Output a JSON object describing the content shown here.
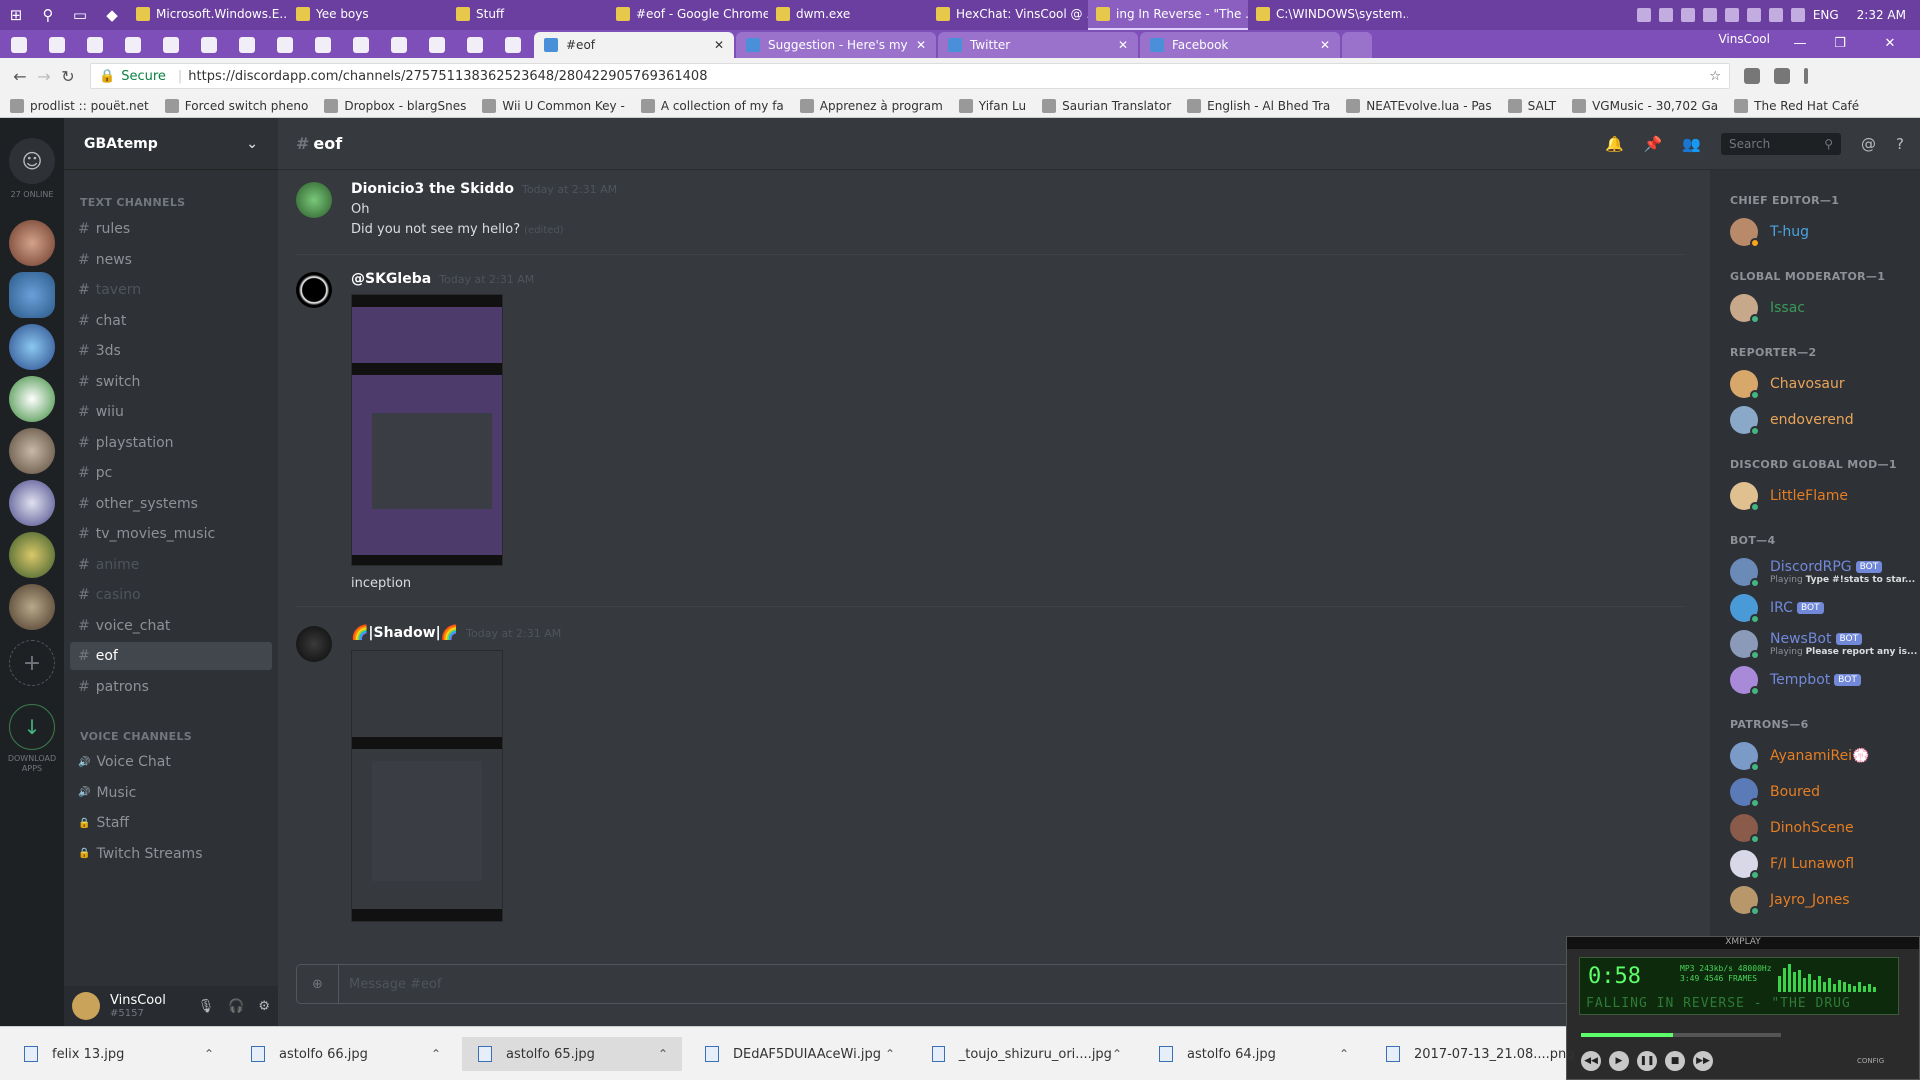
{
  "taskbar": {
    "apps": [
      "Microsoft.Windows.E...",
      "Yee boys",
      "Stuff",
      "#eof - Google Chrome",
      "dwm.exe",
      "HexChat: VinsCool @ ...",
      "ing In Reverse - \"The ...",
      "C:\\WINDOWS\\system..."
    ],
    "active_index": 6,
    "lang": "ENG",
    "clock": "2:32 AM"
  },
  "chrome": {
    "tabs": [
      "#eof",
      "Suggestion - Here's my i",
      "Twitter",
      "Facebook"
    ],
    "window_user": "VinsCool",
    "secure_label": "Secure",
    "url": "https://discordapp.com/channels/275751138362523648/280422905769361408"
  },
  "bookmarks": [
    "prodlist :: pouët.net",
    "Forced switch pheno",
    "Dropbox - blargSnes",
    "Wii U Common Key -",
    "A collection of my fa",
    "Apprenez à program",
    "Yifan Lu",
    "Saurian Translator",
    "English - Al Bhed Tra",
    "NEATEvolve.lua - Pas",
    "SALT",
    "VGMusic - 30,702 Ga",
    "The Red Hat Café"
  ],
  "discord": {
    "online_count": "27 ONLINE",
    "download_label": "DOWNLOAD APPS",
    "server_name": "GBAtemp",
    "text_category": "TEXT CHANNELS",
    "voice_category": "VOICE CHANNELS",
    "text_channels": [
      {
        "name": "rules",
        "dim": false
      },
      {
        "name": "news",
        "dim": false
      },
      {
        "name": "tavern",
        "dim": true
      },
      {
        "name": "chat",
        "dim": false
      },
      {
        "name": "3ds",
        "dim": false
      },
      {
        "name": "switch",
        "dim": false
      },
      {
        "name": "wiiu",
        "dim": false
      },
      {
        "name": "playstation",
        "dim": false
      },
      {
        "name": "pc",
        "dim": false
      },
      {
        "name": "other_systems",
        "dim": false
      },
      {
        "name": "tv_movies_music",
        "dim": false
      },
      {
        "name": "anime",
        "dim": true
      },
      {
        "name": "casino",
        "dim": true
      },
      {
        "name": "voice_chat",
        "dim": false
      },
      {
        "name": "eof",
        "dim": false,
        "selected": true
      },
      {
        "name": "patrons",
        "dim": false
      }
    ],
    "voice_channels": [
      "Voice Chat",
      "Music",
      "Staff",
      "Twitch Streams"
    ],
    "user": {
      "name": "VinsCool",
      "tag": "#5157"
    },
    "channel_title": "eof",
    "search_placeholder": "Search",
    "messages": [
      {
        "author": "Dionicio3 the Skiddo",
        "time": "Today at 2:31 AM",
        "lines": [
          "Oh",
          "Did you not see my hello?"
        ],
        "edited": "(edited)"
      },
      {
        "author": "@SKGleba",
        "time": "Today at 2:31 AM",
        "caption": "inception"
      },
      {
        "author": "🌈|Shadow|🌈",
        "time": "Today at 2:31 AM"
      }
    ],
    "composer_placeholder": "Message #eof",
    "member_groups": [
      {
        "title": "CHIEF EDITOR—1",
        "members": [
          {
            "name": "T-hug",
            "color": "#4aa3df"
          }
        ]
      },
      {
        "title": "GLOBAL MODERATOR—1",
        "members": [
          {
            "name": "Issac",
            "color": "#3a9a5a"
          }
        ]
      },
      {
        "title": "REPORTER—2",
        "members": [
          {
            "name": "Chavosaur",
            "color": "#e8a55a"
          },
          {
            "name": "endoverend",
            "color": "#e8a55a"
          }
        ]
      },
      {
        "title": "DISCORD GLOBAL MOD—1",
        "members": [
          {
            "name": "LittleFlame",
            "color": "#e67e22"
          }
        ]
      },
      {
        "title": "BOT—4",
        "members": [
          {
            "name": "DiscordRPG",
            "color": "#7289da",
            "bot": "BOT",
            "game_prefix": "Playing",
            "game": "Type #!stats to star..."
          },
          {
            "name": "IRC",
            "color": "#7289da",
            "bot": "BOT"
          },
          {
            "name": "NewsBot",
            "color": "#7289da",
            "bot": "BOT",
            "game_prefix": "Playing",
            "game": "Please report any is..."
          },
          {
            "name": "Tempbot",
            "color": "#7289da",
            "bot": "BOT"
          }
        ]
      },
      {
        "title": "PATRONS—6",
        "members": [
          {
            "name": "AyanamiRei💮",
            "color": "#e67e22"
          },
          {
            "name": "Boured",
            "color": "#e67e22"
          },
          {
            "name": "DinohScene",
            "color": "#e67e22"
          },
          {
            "name": "F/I Lunawofl",
            "color": "#e67e22"
          },
          {
            "name": "Jayro_Jones",
            "color": "#e67e22"
          }
        ]
      }
    ]
  },
  "xmplay": {
    "title": "XMPLAY",
    "time": "0:58",
    "info_1": "MP3  243kb/s  48000Hz",
    "info_2": "3:49  4546 FRAMES",
    "song": "FALLING IN REVERSE - \"THE DRUG",
    "config": "CONFIG"
  },
  "downloads": [
    "felix 13.jpg",
    "astolfo 66.jpg",
    "astolfo 65.jpg",
    "DEdAF5DUIAAceWi.jpg",
    "_toujo_shizuru_ori....jpg",
    "astolfo 64.jpg",
    "2017-07-13_21.08....png"
  ],
  "colors": {
    "discord_bg": "#36393e",
    "taskbar": "#6b3fa0",
    "blurple": "#7289da"
  }
}
